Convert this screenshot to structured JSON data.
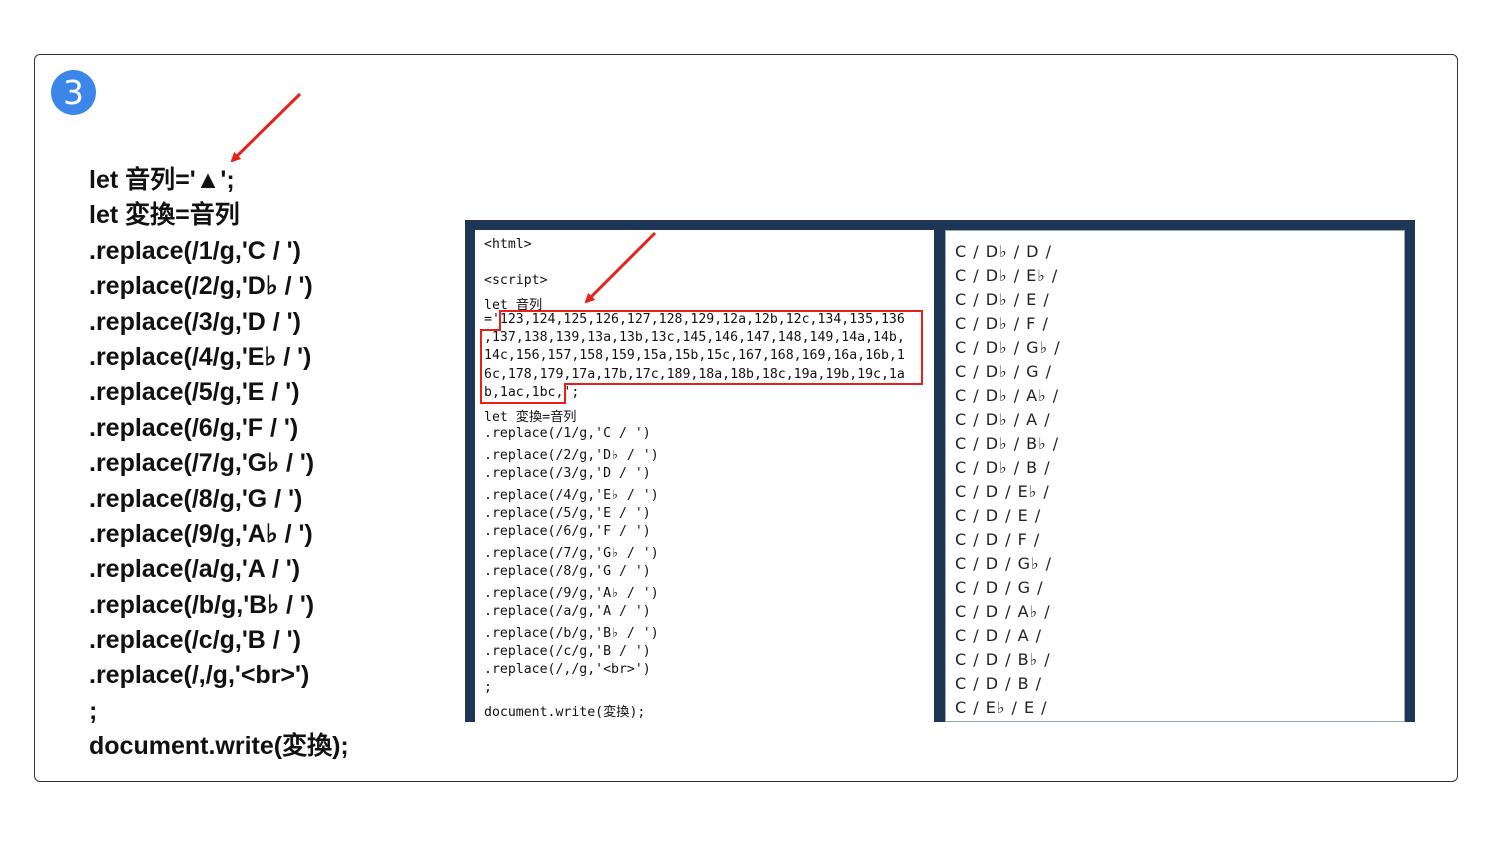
{
  "step": {
    "number": "3"
  },
  "left_code": [
    "let 音列='▲';",
    "let 変換=音列",
    ".replace(/1/g,'C / ')",
    ".replace(/2/g,'D♭ / ')",
    ".replace(/3/g,'D / ')",
    ".replace(/4/g,'E♭ / ')",
    ".replace(/5/g,'E / ')",
    ".replace(/6/g,'F / ')",
    ".replace(/7/g,'G♭ / ')",
    ".replace(/8/g,'G / ')",
    ".replace(/9/g,'A♭ / ')",
    ".replace(/a/g,'A / ')",
    ".replace(/b/g,'B♭ / ')",
    ".replace(/c/g,'B / ')",
    ".replace(/,/g,'<br>')",
    ";",
    "document.write(変換);"
  ],
  "editor": {
    "html_tag": "<html>",
    "script_tag": "<script>",
    "let_decl": "let 音列",
    "value_lines": [
      "='123,124,125,126,127,128,129,12a,12b,12c,134,135,136",
      ",137,138,139,13a,13b,13c,145,146,147,148,149,14a,14b,",
      "14c,156,157,158,159,15a,15b,15c,167,168,169,16a,16b,1",
      "6c,178,179,17a,17b,17c,189,18a,18b,18c,19a,19b,19c,1a",
      "b,1ac,1bc,';"
    ],
    "code_lines": [
      "let 変換=音列",
      ".replace(/1/g,'C / ')",
      ".replace(/2/g,'D♭ / ')",
      ".replace(/3/g,'D / ')",
      ".replace(/4/g,'E♭ / ')",
      ".replace(/5/g,'E / ')",
      ".replace(/6/g,'F / ')",
      ".replace(/7/g,'G♭ / ')",
      ".replace(/8/g,'G / ')",
      ".replace(/9/g,'A♭ / ')",
      ".replace(/a/g,'A / ')",
      ".replace(/b/g,'B♭ / ')",
      ".replace(/c/g,'B / ')",
      ".replace(/,/g,'<br>')",
      ";",
      "document.write(変換);"
    ]
  },
  "result_lines": [
    "C / D♭ / D /",
    "C / D♭ / E♭ /",
    "C / D♭ / E /",
    "C / D♭ / F /",
    "C / D♭ / G♭ /",
    "C / D♭ / G /",
    "C / D♭ / A♭ /",
    "C / D♭ / A /",
    "C / D♭ / B♭ /",
    "C / D♭ / B /",
    "C / D / E♭ /",
    "C / D / E /",
    "C / D / F /",
    "C / D / G♭ /",
    "C / D / G /",
    "C / D / A♭ /",
    "C / D / A /",
    "C / D / B♭ /",
    "C / D / B /",
    "C / E♭ / E /"
  ],
  "colors": {
    "accent": "#e8201a",
    "badge": "#3b86e8",
    "panel": "#1e3656"
  }
}
